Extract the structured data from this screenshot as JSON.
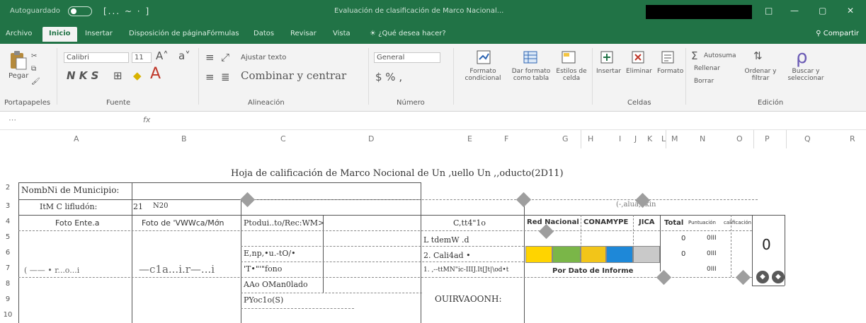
{
  "window": {
    "autosave": "Autoguardado",
    "qat": "[... ~ · ]",
    "title": "Evaluación de clasificación de Marco Nacional...",
    "controls": [
      "□",
      "—",
      "▢",
      "✕"
    ]
  },
  "tabs": {
    "items": [
      "Archivo",
      "Inicio",
      "Insertar",
      "Disposición de página",
      "Fórmulas",
      "Datos",
      "Revisar",
      "Vista"
    ],
    "tell_me": "¿Qué desea hacer?",
    "share": "Compartir"
  },
  "ribbon": {
    "paste": "Pegar",
    "clipboard": "Portapapeles",
    "font_name": "Calibri",
    "font_size": "11",
    "bold_italic": "N K S",
    "font_a": "A",
    "font_group": "Fuente",
    "wrap": "Ajustar texto",
    "alignment": "Alineación",
    "merge": "Combinar y centrar",
    "number_format": "General",
    "number_group": "Número",
    "cond_format": "Formato condicional",
    "format_table": "Dar formato como tabla",
    "cell_styles": "Estilos de celda",
    "insert": "Insertar",
    "delete": "Eliminar",
    "format": "Formato",
    "cells_group": "Celdas",
    "autosum": "Autosuma",
    "fill": "Rellenar",
    "clear": "Borrar",
    "sort_filter": "Ordenar y filtrar",
    "find_select": "Buscar y seleccionar",
    "editing_group": "Edición"
  },
  "formula_bar": {
    "name_box": "",
    "fx": "fx"
  },
  "columns": [
    "A",
    "B",
    "C",
    "D",
    "E",
    "F",
    "G",
    "H",
    "I",
    "J",
    "K",
    "L",
    "M",
    "N",
    "O",
    "P",
    "Q",
    "R"
  ],
  "sheet": {
    "title": "Hoja de calificación de Marco Nocional de Un ,uello Un ,,oducto(2D11)",
    "rows": [
      "2",
      "3",
      "4",
      "5",
      "6",
      "7",
      "8",
      "9",
      "10"
    ],
    "municipio_label": "NombNi de Municipio:",
    "clasificacion_label": "ItM C lifludón:",
    "clasificacion_value": "21",
    "clasificacion_extra": "N20",
    "foto_ente": "Foto Ente.a",
    "foto_de": "Foto de 'VWWca/Mớn",
    "producto": "Ptodui..to/Rec:WM>",
    "categoria": "C,tt4\"1o",
    "evaluacion": "(-,alua,ckin",
    "red_nacional": "Red Nacional",
    "conamype": "CONAMYPE",
    "jica": "JICA",
    "total": "Total",
    "puntuacion": "Puntuación",
    "calificacion": "calificación",
    "c_items": [
      "E,np,•u.-tO/•",
      "'T•\"'\"fono",
      "AAo OMan0lado",
      "PYoc1o(S)"
    ],
    "d_items": [
      "L tdemW .d",
      "2. Cali4ad •",
      "1. ,--ttMN\"ic-IIIJ.It[Jt|\\od•t"
    ],
    "obs": "OUIRVAOONH:",
    "por_dato": "Por Dato de Informe",
    "total_values": [
      "0",
      "0"
    ],
    "punt_values": [
      "0III",
      "0III",
      "0III"
    ],
    "big_score": "0",
    "swatch_colors": [
      "#ffd400",
      "#7ab648",
      "#f2c519",
      "#1e88d8",
      "#c9c9c9"
    ],
    "row7_left_a": "( —— •  r...o...i",
    "row7_left_b": "—c1a...i.r—...i"
  }
}
